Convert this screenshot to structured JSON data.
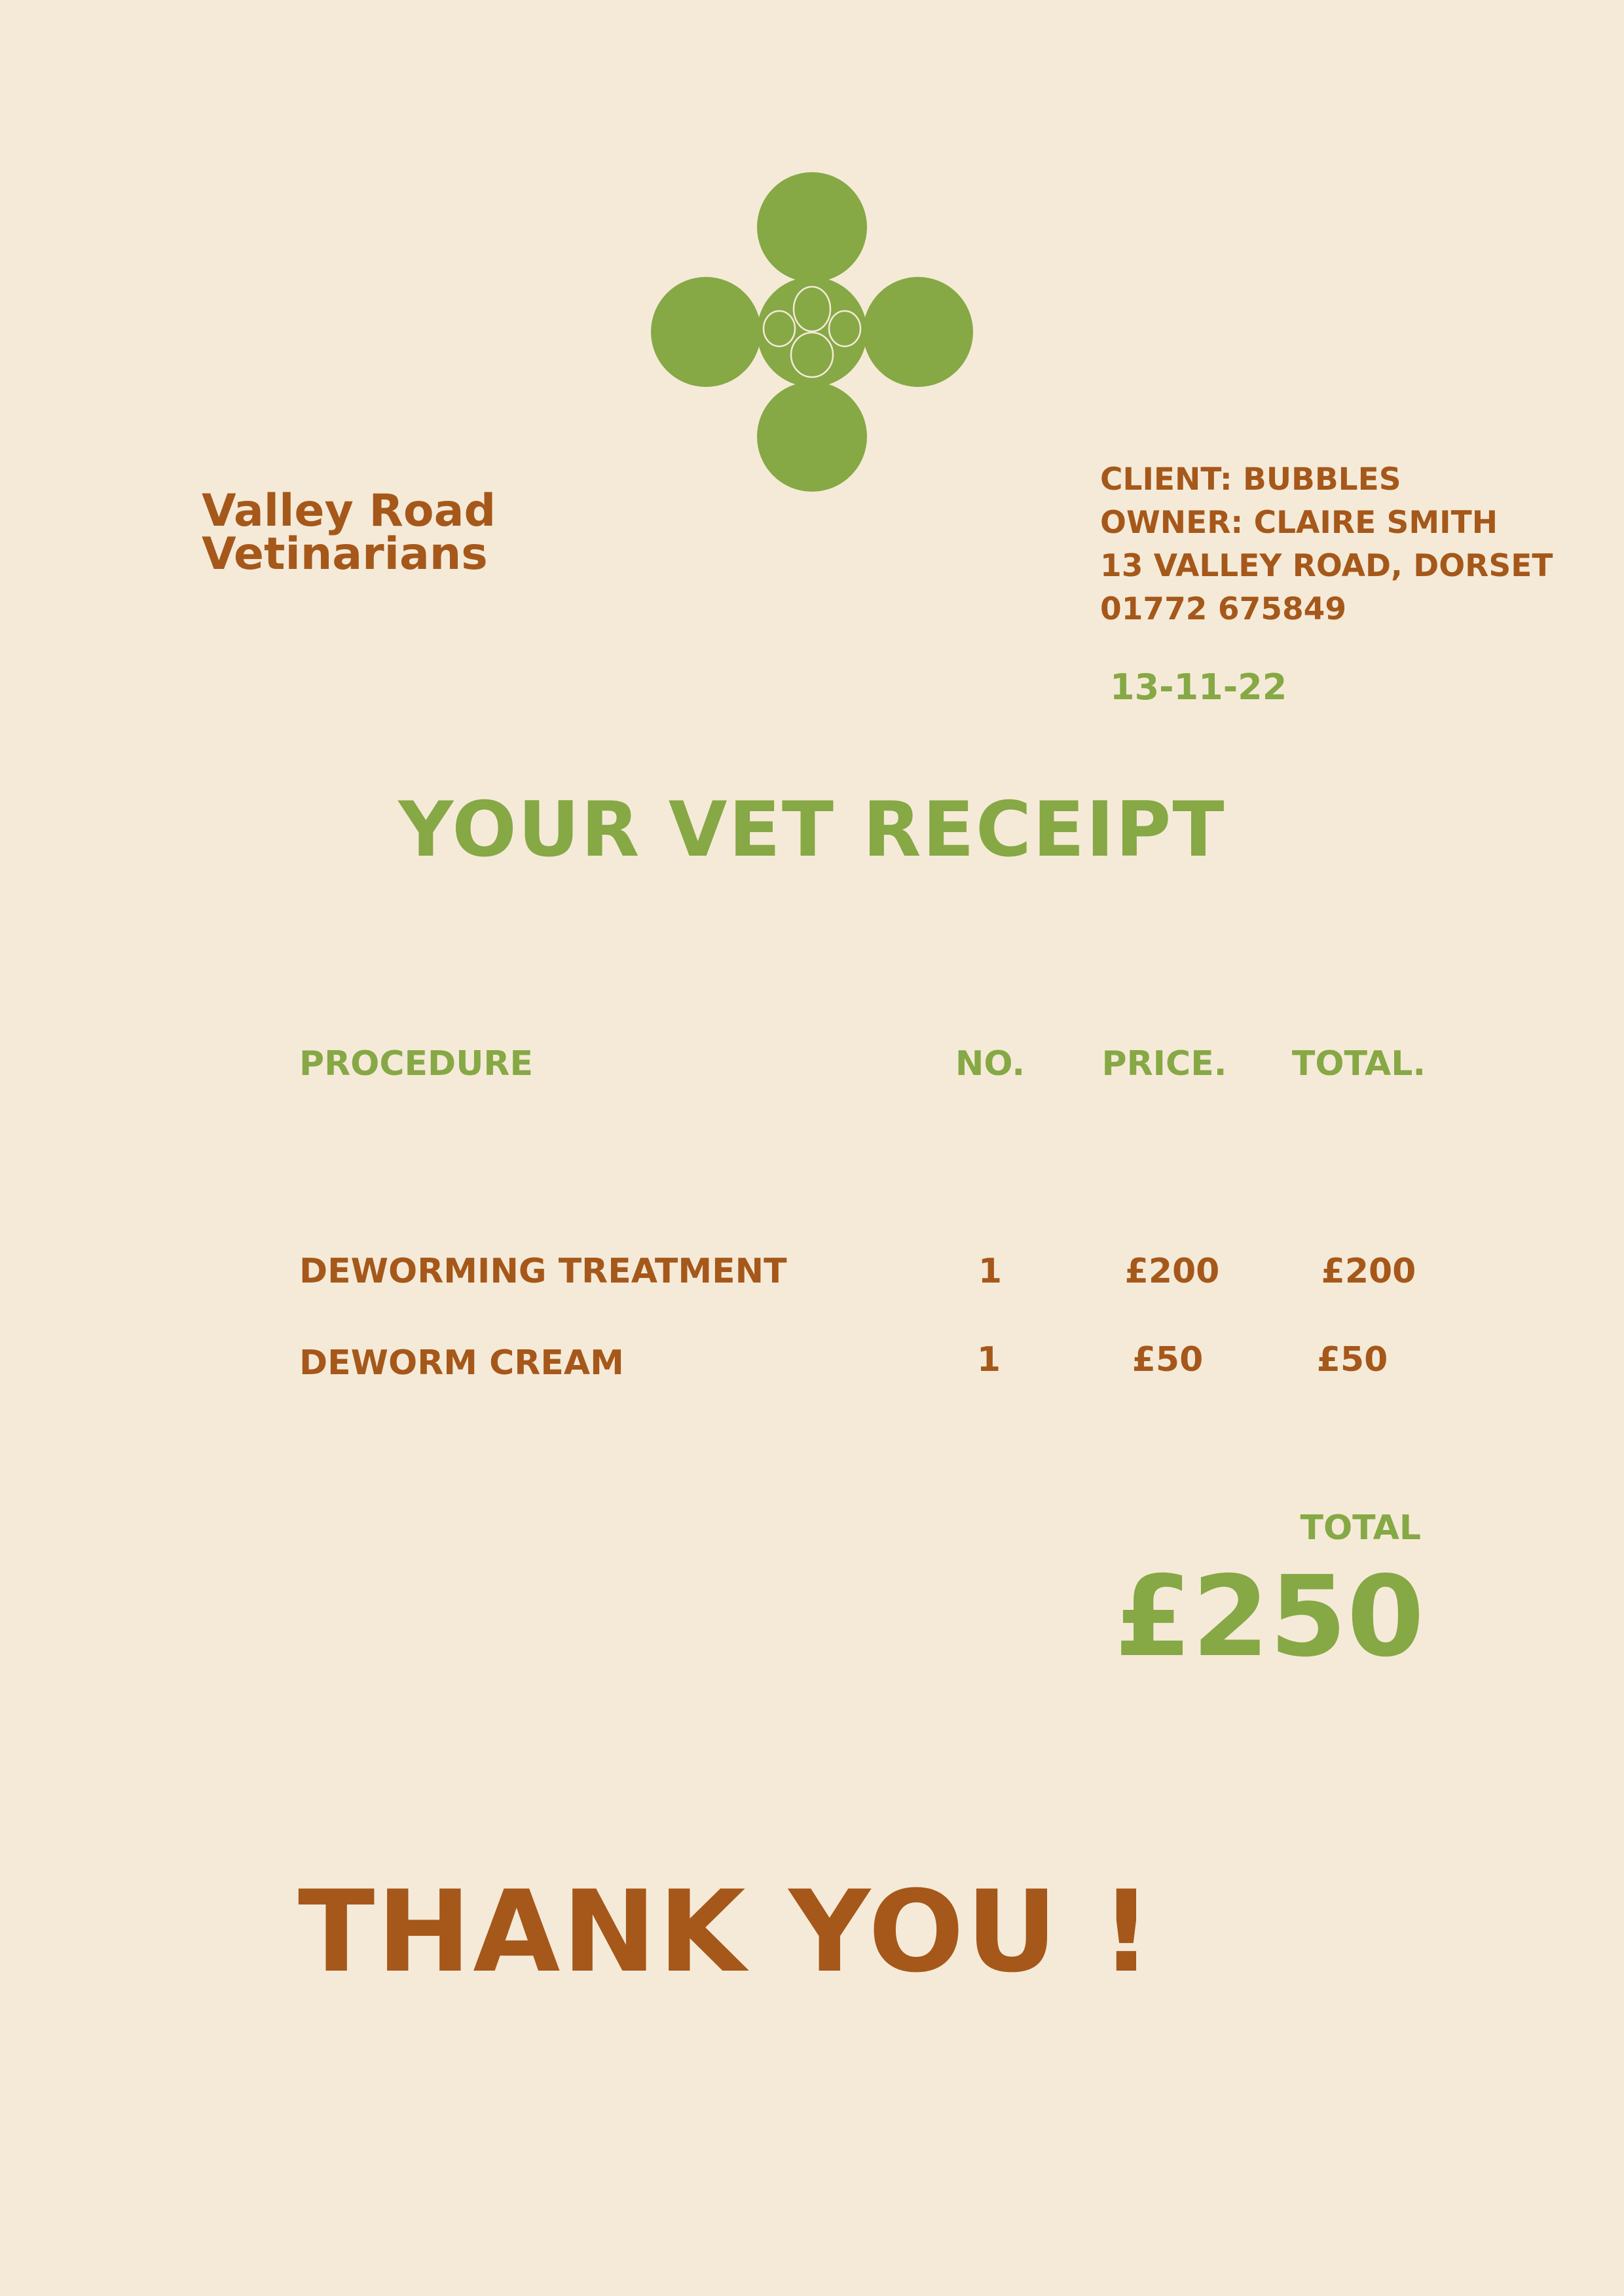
{
  "brand": {
    "name_line1": "Valley Road",
    "name_line2": "Vetinarians"
  },
  "client": {
    "client": "CLIENT: BUBBLES",
    "owner": "OWNER: CLAIRE SMITH",
    "address": "13 VALLEY ROAD, DORSET",
    "phone": "01772 675849"
  },
  "date": "13-11-22",
  "title": "YOUR VET RECEIPT",
  "table": {
    "headers": {
      "procedure": "PROCEDURE",
      "no": "NO.",
      "price": "PRICE.",
      "total": "TOTAL."
    },
    "rows": [
      {
        "procedure": "DEWORMING TREATMENT",
        "no": "1",
        "price": "£200",
        "total": "£200"
      },
      {
        "procedure": "DEWORM CREAM",
        "no": "1",
        "price": "£50",
        "total": "£50"
      }
    ]
  },
  "summary": {
    "label": "TOTAL",
    "value": "£250"
  },
  "footer": {
    "thanks": "THANK YOU !"
  },
  "colors": {
    "background": "#f5ead8",
    "green": "#86a845",
    "brown": "#a5581a"
  },
  "icons": {
    "logo": "paw-clover-logo-icon"
  }
}
